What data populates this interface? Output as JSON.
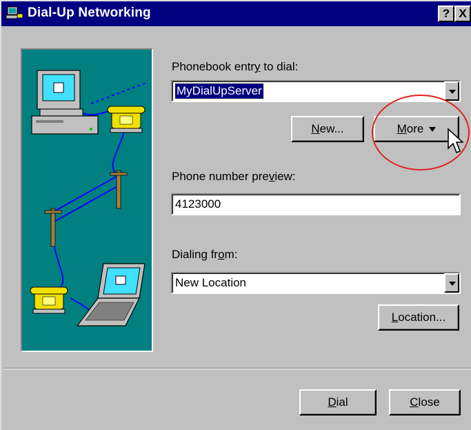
{
  "window": {
    "title": "Dial-Up Networking",
    "help_label": "?",
    "close_label": "X"
  },
  "phonebook": {
    "label_pre": "Phonebook entr",
    "label_hot": "y",
    "label_post": " to dial:",
    "value": "MyDialUpServer"
  },
  "buttons": {
    "new_hot": "N",
    "new_rest": "ew...",
    "more_hot": "M",
    "more_rest": "ore",
    "location_hot": "L",
    "location_rest": "ocation...",
    "dial_hot": "D",
    "dial_rest": "ial",
    "close_hot": "C",
    "close_rest": "lose"
  },
  "preview": {
    "label_pre": "Phone number pre",
    "label_hot": "v",
    "label_post": "iew:",
    "value": "4123000"
  },
  "dialing_from": {
    "label_pre": "Dialing fr",
    "label_hot": "o",
    "label_post": "m:",
    "value": "New Location"
  },
  "icons": {
    "title": "dial-up-networking-icon",
    "illustration": "computer-modem-phone-laptop-illustration",
    "cursor": "arrow-cursor-icon"
  },
  "colors": {
    "titlebar": "#000080",
    "face": "#c0c0c0",
    "illustration_bg": "#008080",
    "highlight": "#000080",
    "annotation": "#e02020"
  }
}
